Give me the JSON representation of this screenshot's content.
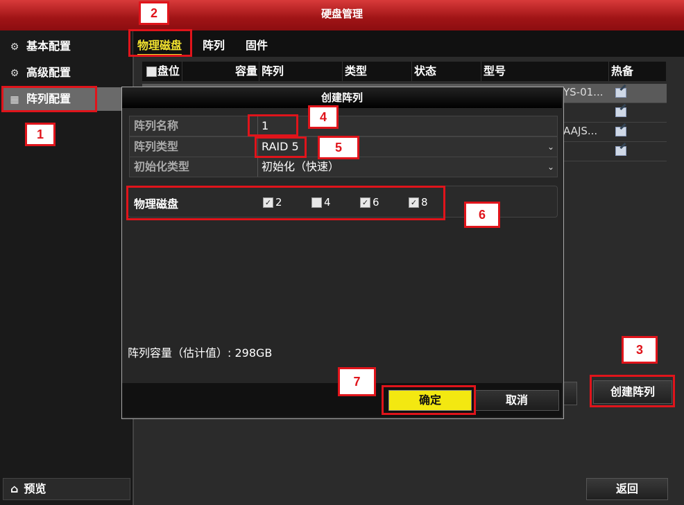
{
  "window": {
    "title": "硬盘管理"
  },
  "sidebar": {
    "items": [
      {
        "label": "基本配置",
        "icon": "gear-icon"
      },
      {
        "label": "高级配置",
        "icon": "gears-icon"
      },
      {
        "label": "阵列配置",
        "icon": "grid-icon",
        "active": true
      }
    ],
    "preview": {
      "label": "预览",
      "icon": "home-icon"
    }
  },
  "tabs": [
    {
      "label": "物理磁盘",
      "active": true
    },
    {
      "label": "阵列"
    },
    {
      "label": "固件"
    }
  ],
  "table": {
    "columns": [
      "盘位",
      "容量",
      "阵列",
      "类型",
      "状态",
      "型号",
      "热备"
    ],
    "rows": [
      {
        "model": "YS-01..."
      },
      {
        "model": ""
      },
      {
        "model": "AAJS..."
      },
      {
        "model": ""
      }
    ]
  },
  "buttons": {
    "create_array": "创建阵列",
    "back": "返回"
  },
  "dialog": {
    "title": "创建阵列",
    "fields": {
      "name": {
        "label": "阵列名称",
        "value": "1"
      },
      "type": {
        "label": "阵列类型",
        "value": "RAID 5"
      },
      "init": {
        "label": "初始化类型",
        "value": "初始化（快速）"
      }
    },
    "disks": {
      "label": "物理磁盘",
      "items": [
        {
          "label": "2",
          "checked": true
        },
        {
          "label": "4",
          "checked": false
        },
        {
          "label": "6",
          "checked": true
        },
        {
          "label": "8",
          "checked": true
        }
      ]
    },
    "capacity": "阵列容量（估计值）: 298GB",
    "ok": "确定",
    "cancel": "取消"
  },
  "callouts": [
    "1",
    "2",
    "3",
    "4",
    "5",
    "6",
    "7"
  ],
  "colors": {
    "accent": "#f3e811",
    "titlebar": "#a01416",
    "callout": "#e0141b"
  }
}
